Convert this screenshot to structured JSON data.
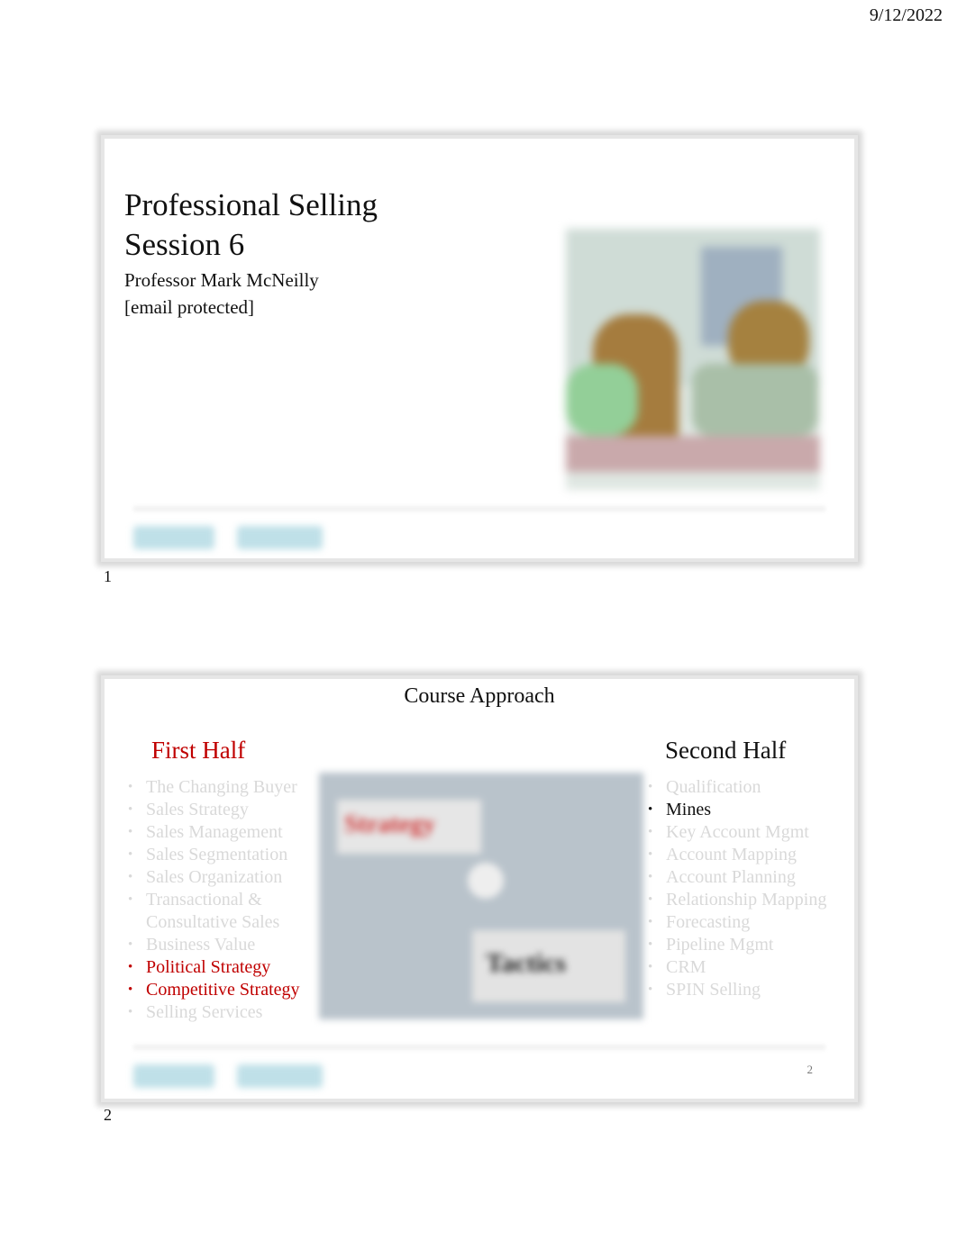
{
  "header": {
    "date": "9/12/2022"
  },
  "slides": [
    {
      "number": "1",
      "title_line1": "Professional Selling",
      "title_line2": "Session 6",
      "presenter": "Professor Mark McNeilly",
      "email": "[email protected]"
    },
    {
      "number": "2",
      "page_label": "2",
      "title": "Course Approach",
      "image_words": [
        "Strategy",
        "Tactics"
      ],
      "first_half": {
        "heading": "First Half",
        "items": [
          {
            "text": "The Changing Buyer",
            "state": "dim"
          },
          {
            "text": "Sales Strategy",
            "state": "dim"
          },
          {
            "text": "Sales Management",
            "state": "dim"
          },
          {
            "text": "Sales Segmentation",
            "state": "dim"
          },
          {
            "text": "Sales Organization",
            "state": "dim"
          },
          {
            "text": "Transactional & Consultative Sales",
            "state": "dim"
          },
          {
            "text": "Business Value",
            "state": "dim"
          },
          {
            "text": "Political Strategy",
            "state": "red"
          },
          {
            "text": "Competitive Strategy",
            "state": "red"
          },
          {
            "text": "Selling Services",
            "state": "dim"
          }
        ]
      },
      "second_half": {
        "heading": "Second Half",
        "items": [
          {
            "text": "Qualification",
            "state": "dim"
          },
          {
            "text": "Mines",
            "state": "blk"
          },
          {
            "text": "Key Account Mgmt",
            "state": "dim"
          },
          {
            "text": "Account Mapping",
            "state": "dim"
          },
          {
            "text": "Account Planning",
            "state": "dim"
          },
          {
            "text": "Relationship Mapping",
            "state": "dim"
          },
          {
            "text": "Forecasting",
            "state": "dim"
          },
          {
            "text": "Pipeline Mgmt",
            "state": "dim"
          },
          {
            "text": "CRM",
            "state": "dim"
          },
          {
            "text": "SPIN Selling",
            "state": "dim"
          }
        ]
      }
    }
  ],
  "colors": {
    "accent_red": "#c00000",
    "dim_text": "#d9d9d9"
  }
}
